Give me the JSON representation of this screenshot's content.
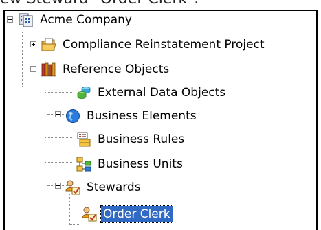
{
  "caption": "ew Steward \"Order Clerk\".",
  "tree": {
    "root": "Acme Company",
    "project": "Compliance Reinstatement Project",
    "reference": "Reference Objects",
    "external": "External Data Objects",
    "elements": "Business Elements",
    "rules": "Business Rules",
    "units": "Business Units",
    "stewards": "Stewards",
    "order_clerk": "Order Clerk"
  },
  "colors": {
    "selection": "#316ac5",
    "tree_lines": "#8c8c8c"
  }
}
